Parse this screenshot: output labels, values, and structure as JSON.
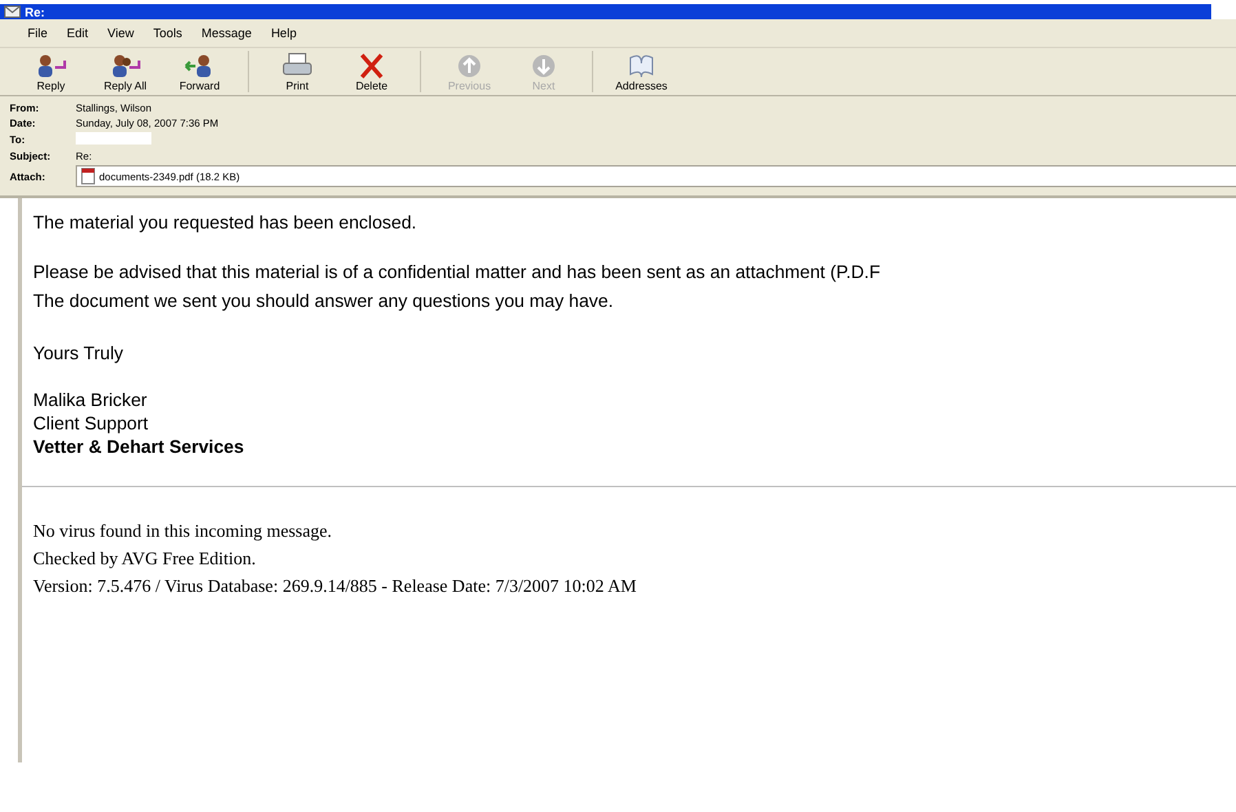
{
  "window": {
    "title": "Re:"
  },
  "menu": [
    "File",
    "Edit",
    "View",
    "Tools",
    "Message",
    "Help"
  ],
  "toolbar": [
    {
      "label": "Reply",
      "kind": "reply",
      "disabled": false
    },
    {
      "label": "Reply All",
      "kind": "reply-all",
      "disabled": false
    },
    {
      "label": "Forward",
      "kind": "forward",
      "disabled": false
    },
    {
      "label": "Print",
      "kind": "print",
      "disabled": false
    },
    {
      "label": "Delete",
      "kind": "delete",
      "disabled": false
    },
    {
      "label": "Previous",
      "kind": "previous",
      "disabled": true
    },
    {
      "label": "Next",
      "kind": "next",
      "disabled": true
    },
    {
      "label": "Addresses",
      "kind": "addresses",
      "disabled": false
    }
  ],
  "header": {
    "from_label": "From:",
    "from": "Stallings, Wilson",
    "date_label": "Date:",
    "date": "Sunday, July 08, 2007 7:36 PM",
    "to_label": "To:",
    "subject_label": "Subject:",
    "subject": "Re:",
    "attach_label": "Attach:",
    "attachment": "documents-2349.pdf (18.2 KB)"
  },
  "body": {
    "paragraphs": [
      "The material you requested has been enclosed.",
      "Please be advised that this material is of a confidential matter and has been sent as an attachment (P.D.F",
      "The document we sent you should answer any questions you may have.",
      "Yours Truly"
    ],
    "signature": [
      "Malika Bricker",
      "Client Support",
      "Vetter & Dehart Services"
    ],
    "footer": [
      "No virus found in this incoming message.",
      "Checked by AVG Free Edition.",
      "Version: 7.5.476 / Virus Database: 269.9.14/885 - Release Date: 7/3/2007 10:02 AM"
    ]
  }
}
